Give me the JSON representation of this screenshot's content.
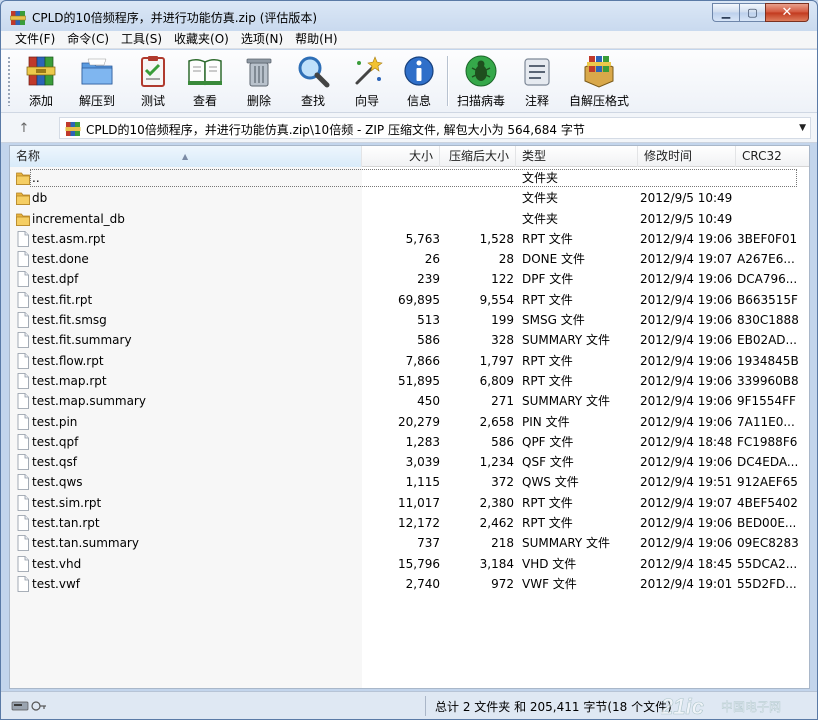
{
  "window": {
    "title": "CPLD的10倍频程序，并进行功能仿真.zip (评估版本)"
  },
  "menu": [
    "文件(F)",
    "命令(C)",
    "工具(S)",
    "收藏夹(O)",
    "选项(N)",
    "帮助(H)"
  ],
  "toolbar": {
    "add": "添加",
    "extract": "解压到",
    "test": "测试",
    "view": "查看",
    "delete": "删除",
    "find": "查找",
    "wizard": "向导",
    "info": "信息",
    "virus": "扫描病毒",
    "comment": "注释",
    "sfx": "自解压格式"
  },
  "address": {
    "text": "CPLD的10倍频程序，并进行功能仿真.zip\\10倍频 - ZIP 压缩文件, 解包大小为 564,684 字节"
  },
  "columns": {
    "name": "名称",
    "size": "大小",
    "packed": "压缩后大小",
    "type": "类型",
    "modified": "修改时间",
    "crc": "CRC32"
  },
  "files": [
    {
      "name": "..",
      "size": "",
      "packed": "",
      "type": "文件夹",
      "modified": "",
      "crc": "",
      "folder": true
    },
    {
      "name": "db",
      "size": "",
      "packed": "",
      "type": "文件夹",
      "modified": "2012/9/5 10:49",
      "crc": "",
      "folder": true
    },
    {
      "name": "incremental_db",
      "size": "",
      "packed": "",
      "type": "文件夹",
      "modified": "2012/9/5 10:49",
      "crc": "",
      "folder": true
    },
    {
      "name": "test.asm.rpt",
      "size": "5,763",
      "packed": "1,528",
      "type": "RPT 文件",
      "modified": "2012/9/4 19:06",
      "crc": "3BEF0F01"
    },
    {
      "name": "test.done",
      "size": "26",
      "packed": "28",
      "type": "DONE 文件",
      "modified": "2012/9/4 19:07",
      "crc": "A267E6..."
    },
    {
      "name": "test.dpf",
      "size": "239",
      "packed": "122",
      "type": "DPF 文件",
      "modified": "2012/9/4 19:06",
      "crc": "DCA796..."
    },
    {
      "name": "test.fit.rpt",
      "size": "69,895",
      "packed": "9,554",
      "type": "RPT 文件",
      "modified": "2012/9/4 19:06",
      "crc": "B663515F"
    },
    {
      "name": "test.fit.smsg",
      "size": "513",
      "packed": "199",
      "type": "SMSG 文件",
      "modified": "2012/9/4 19:06",
      "crc": "830C1888"
    },
    {
      "name": "test.fit.summary",
      "size": "586",
      "packed": "328",
      "type": "SUMMARY 文件",
      "modified": "2012/9/4 19:06",
      "crc": "EB02AD..."
    },
    {
      "name": "test.flow.rpt",
      "size": "7,866",
      "packed": "1,797",
      "type": "RPT 文件",
      "modified": "2012/9/4 19:06",
      "crc": "1934845B"
    },
    {
      "name": "test.map.rpt",
      "size": "51,895",
      "packed": "6,809",
      "type": "RPT 文件",
      "modified": "2012/9/4 19:06",
      "crc": "339960B8"
    },
    {
      "name": "test.map.summary",
      "size": "450",
      "packed": "271",
      "type": "SUMMARY 文件",
      "modified": "2012/9/4 19:06",
      "crc": "9F1554FF"
    },
    {
      "name": "test.pin",
      "size": "20,279",
      "packed": "2,658",
      "type": "PIN 文件",
      "modified": "2012/9/4 19:06",
      "crc": "7A11E0..."
    },
    {
      "name": "test.qpf",
      "size": "1,283",
      "packed": "586",
      "type": "QPF 文件",
      "modified": "2012/9/4 18:48",
      "crc": "FC1988F6"
    },
    {
      "name": "test.qsf",
      "size": "3,039",
      "packed": "1,234",
      "type": "QSF 文件",
      "modified": "2012/9/4 19:06",
      "crc": "DC4EDA..."
    },
    {
      "name": "test.qws",
      "size": "1,115",
      "packed": "372",
      "type": "QWS 文件",
      "modified": "2012/9/4 19:51",
      "crc": "912AEF65"
    },
    {
      "name": "test.sim.rpt",
      "size": "11,017",
      "packed": "2,380",
      "type": "RPT 文件",
      "modified": "2012/9/4 19:07",
      "crc": "4BEF5402"
    },
    {
      "name": "test.tan.rpt",
      "size": "12,172",
      "packed": "2,462",
      "type": "RPT 文件",
      "modified": "2012/9/4 19:06",
      "crc": "BED00E..."
    },
    {
      "name": "test.tan.summary",
      "size": "737",
      "packed": "218",
      "type": "SUMMARY 文件",
      "modified": "2012/9/4 19:06",
      "crc": "09EC8283"
    },
    {
      "name": "test.vhd",
      "size": "15,796",
      "packed": "3,184",
      "type": "VHD 文件",
      "modified": "2012/9/4 18:45",
      "crc": "55DCA2..."
    },
    {
      "name": "test.vwf",
      "size": "2,740",
      "packed": "972",
      "type": "VWF 文件",
      "modified": "2012/9/4 19:01",
      "crc": "55D2FD..."
    }
  ],
  "status": {
    "text": "总计 2 文件夹 和 205,411 字节(18 个文件)"
  },
  "watermark": {
    "text": "21ic",
    "subtext": "中国电子网"
  }
}
